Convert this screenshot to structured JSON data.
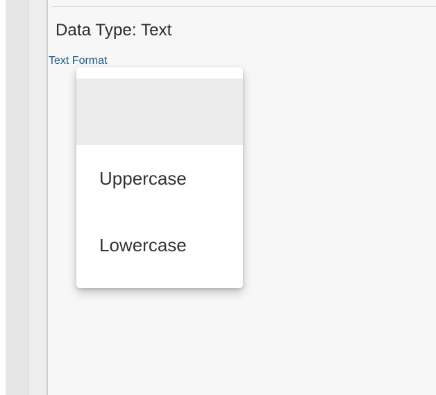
{
  "field": {
    "data_type_label": "Data Type: Text",
    "text_format_label": "Text Format"
  },
  "dropdown": {
    "options": [
      "",
      "Uppercase",
      "Lowercase"
    ],
    "highlighted_option": ""
  },
  "colors": {
    "panel_background": "#f7f7f7",
    "label_link_blue": "#1a5a8a",
    "menu_highlight": "#ececec",
    "menu_background": "#ffffff"
  }
}
